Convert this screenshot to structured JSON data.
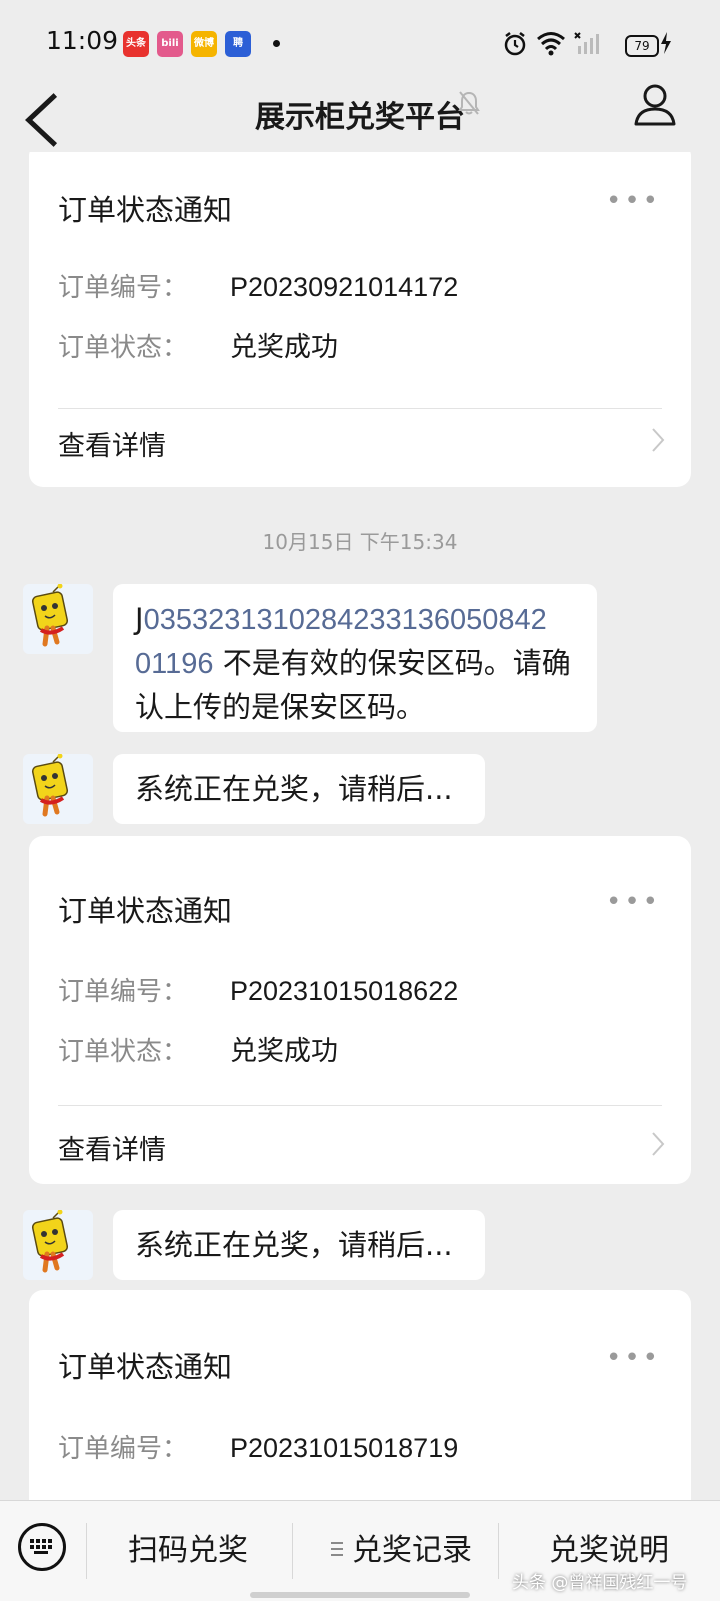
{
  "status_bar": {
    "time": "11:09",
    "battery": "79",
    "apps": [
      {
        "label": "头条",
        "color": "#e8322e"
      },
      {
        "label": "bili",
        "color": "#e35a8c"
      },
      {
        "label": "微博",
        "color": "#f5b400"
      },
      {
        "label": "聘",
        "color": "#2c5fd6"
      }
    ]
  },
  "header": {
    "title": "展示柜兑奖平台"
  },
  "feed": {
    "cards": [
      {
        "title": "订单状态通知",
        "more": "•••",
        "order_no_label": "订单编号：",
        "order_no": "P20230921014172",
        "status_label": "订单状态：",
        "status": "兑奖成功",
        "detail": "查看详情"
      },
      {
        "title": "订单状态通知",
        "more": "•••",
        "order_no_label": "订单编号：",
        "order_no": "P20231015018622",
        "status_label": "订单状态：",
        "status": "兑奖成功",
        "detail": "查看详情"
      },
      {
        "title": "订单状态通知",
        "more": "•••",
        "order_no_label": "订单编号：",
        "order_no": "P20231015018719"
      }
    ],
    "timestamp": "10月15日 下午15:34",
    "messages": [
      {
        "prefix": "J",
        "link": "0353231310284233136050842 01196",
        "text": " 不是有效的保安区码。请确认上传的是保安区码。"
      },
      {
        "text": "系统正在兑奖，请稍后..."
      },
      {
        "text": "系统正在兑奖，请稍后..."
      }
    ]
  },
  "bottom_menu": {
    "items": [
      "扫码兑奖",
      "兑奖记录",
      "兑奖说明"
    ]
  },
  "watermark": "头条 @曾祥国残红一号"
}
